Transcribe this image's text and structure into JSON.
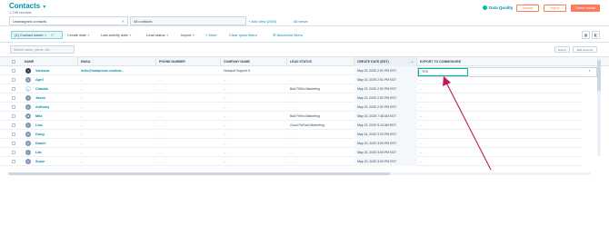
{
  "header": {
    "title": "Contacts",
    "record_count": "1,746 records",
    "data_quality": "Data Quality",
    "actions_label": "Actions",
    "import_label": "Import",
    "create_label": "Create contact"
  },
  "views": {
    "tabs": [
      {
        "label": "Unassigned contacts"
      },
      {
        "label": "All contacts"
      }
    ],
    "add_view": "+ Add view (2/50)",
    "all_views": "All views"
  },
  "filters": {
    "contact_owner": "(1) Contact owner",
    "create_date": "Create date",
    "last_activity": "Last activity date",
    "lead_status": "Lead status",
    "import": "Import",
    "more": "+ More",
    "clear": "Clear quick filters",
    "advanced": "Advanced filters"
  },
  "search": {
    "placeholder": "Search name, phone, em...",
    "export_label": "Export",
    "edit_columns_label": "Edit columns"
  },
  "table": {
    "columns": [
      "NAME",
      "EMAIL",
      "PHONE NUMBER",
      "COMPANY NAME",
      "LEAD STATUS",
      "CREATE DATE (EDT)",
      "EXPORT TO COMMODORE"
    ],
    "rows": [
      {
        "initial": "V",
        "name": "Vanessa",
        "email": "hello@madperson.mw/test...",
        "phone": "--",
        "company": "Hubspot Support 5",
        "lead": "--",
        "date": "May 15, 2020 2:51 PM EDT",
        "export": "YES"
      },
      {
        "initial": "A",
        "name": "April",
        "email": "--",
        "phone": "--",
        "company": "--",
        "lead": "--",
        "date": "May 15, 2020 2:51 PM EDT",
        "export": "--"
      },
      {
        "initial": "C",
        "name": "Claudia",
        "email": "--",
        "phone": "--",
        "company": "--",
        "lead": "Bad Fit/No Marketing",
        "date": "May 15, 2020 2:52 PM EDT",
        "export": "--"
      },
      {
        "initial": "J",
        "name": "Jason",
        "email": "--",
        "phone": "--",
        "company": "--",
        "lead": "--",
        "date": "May 15, 2020 2:52 PM EDT",
        "export": "--"
      },
      {
        "initial": "A",
        "name": "Anthony",
        "email": "--",
        "phone": "--",
        "company": "--",
        "lead": "--",
        "date": "May 15, 2020 2:52 PM EDT",
        "export": "--"
      },
      {
        "initial": "M",
        "name": "Mila",
        "email": "--",
        "phone": "--",
        "company": "--",
        "lead": "Bad Fit/No Marketing",
        "date": "May 15, 2020 7:48 AM EDT",
        "export": "--"
      },
      {
        "initial": "L",
        "name": "Lisa",
        "email": "--",
        "phone": "--",
        "company": "--",
        "lead": "Good Fit/Sold Marketing",
        "date": "May 15, 2020 9:13 AM EDT",
        "export": "--"
      },
      {
        "initial": "D",
        "name": "Doug",
        "email": "--",
        "phone": "--",
        "company": "--",
        "lead": "--",
        "date": "May 14, 2020 3:23 PM EDT",
        "export": "--"
      },
      {
        "initial": "D",
        "name": "Daniel",
        "email": "--",
        "phone": "--",
        "company": "--",
        "lead": "--",
        "date": "May 20, 2020 3:09 PM EDT",
        "export": "--"
      },
      {
        "initial": "L",
        "name": "Lila",
        "email": "--",
        "phone": "--",
        "company": "--",
        "lead": "--",
        "date": "May 20, 2020 3:09 PM EDT",
        "export": "--"
      },
      {
        "initial": "S",
        "name": "Susie",
        "email": "--",
        "phone": "--",
        "company": "--",
        "lead": "--",
        "date": "May 20, 2020 3:09 PM EDT",
        "export": "--"
      }
    ]
  },
  "annotation_color": "#c2185b",
  "accent": "#ff7a59",
  "link_color": "#0091ae"
}
